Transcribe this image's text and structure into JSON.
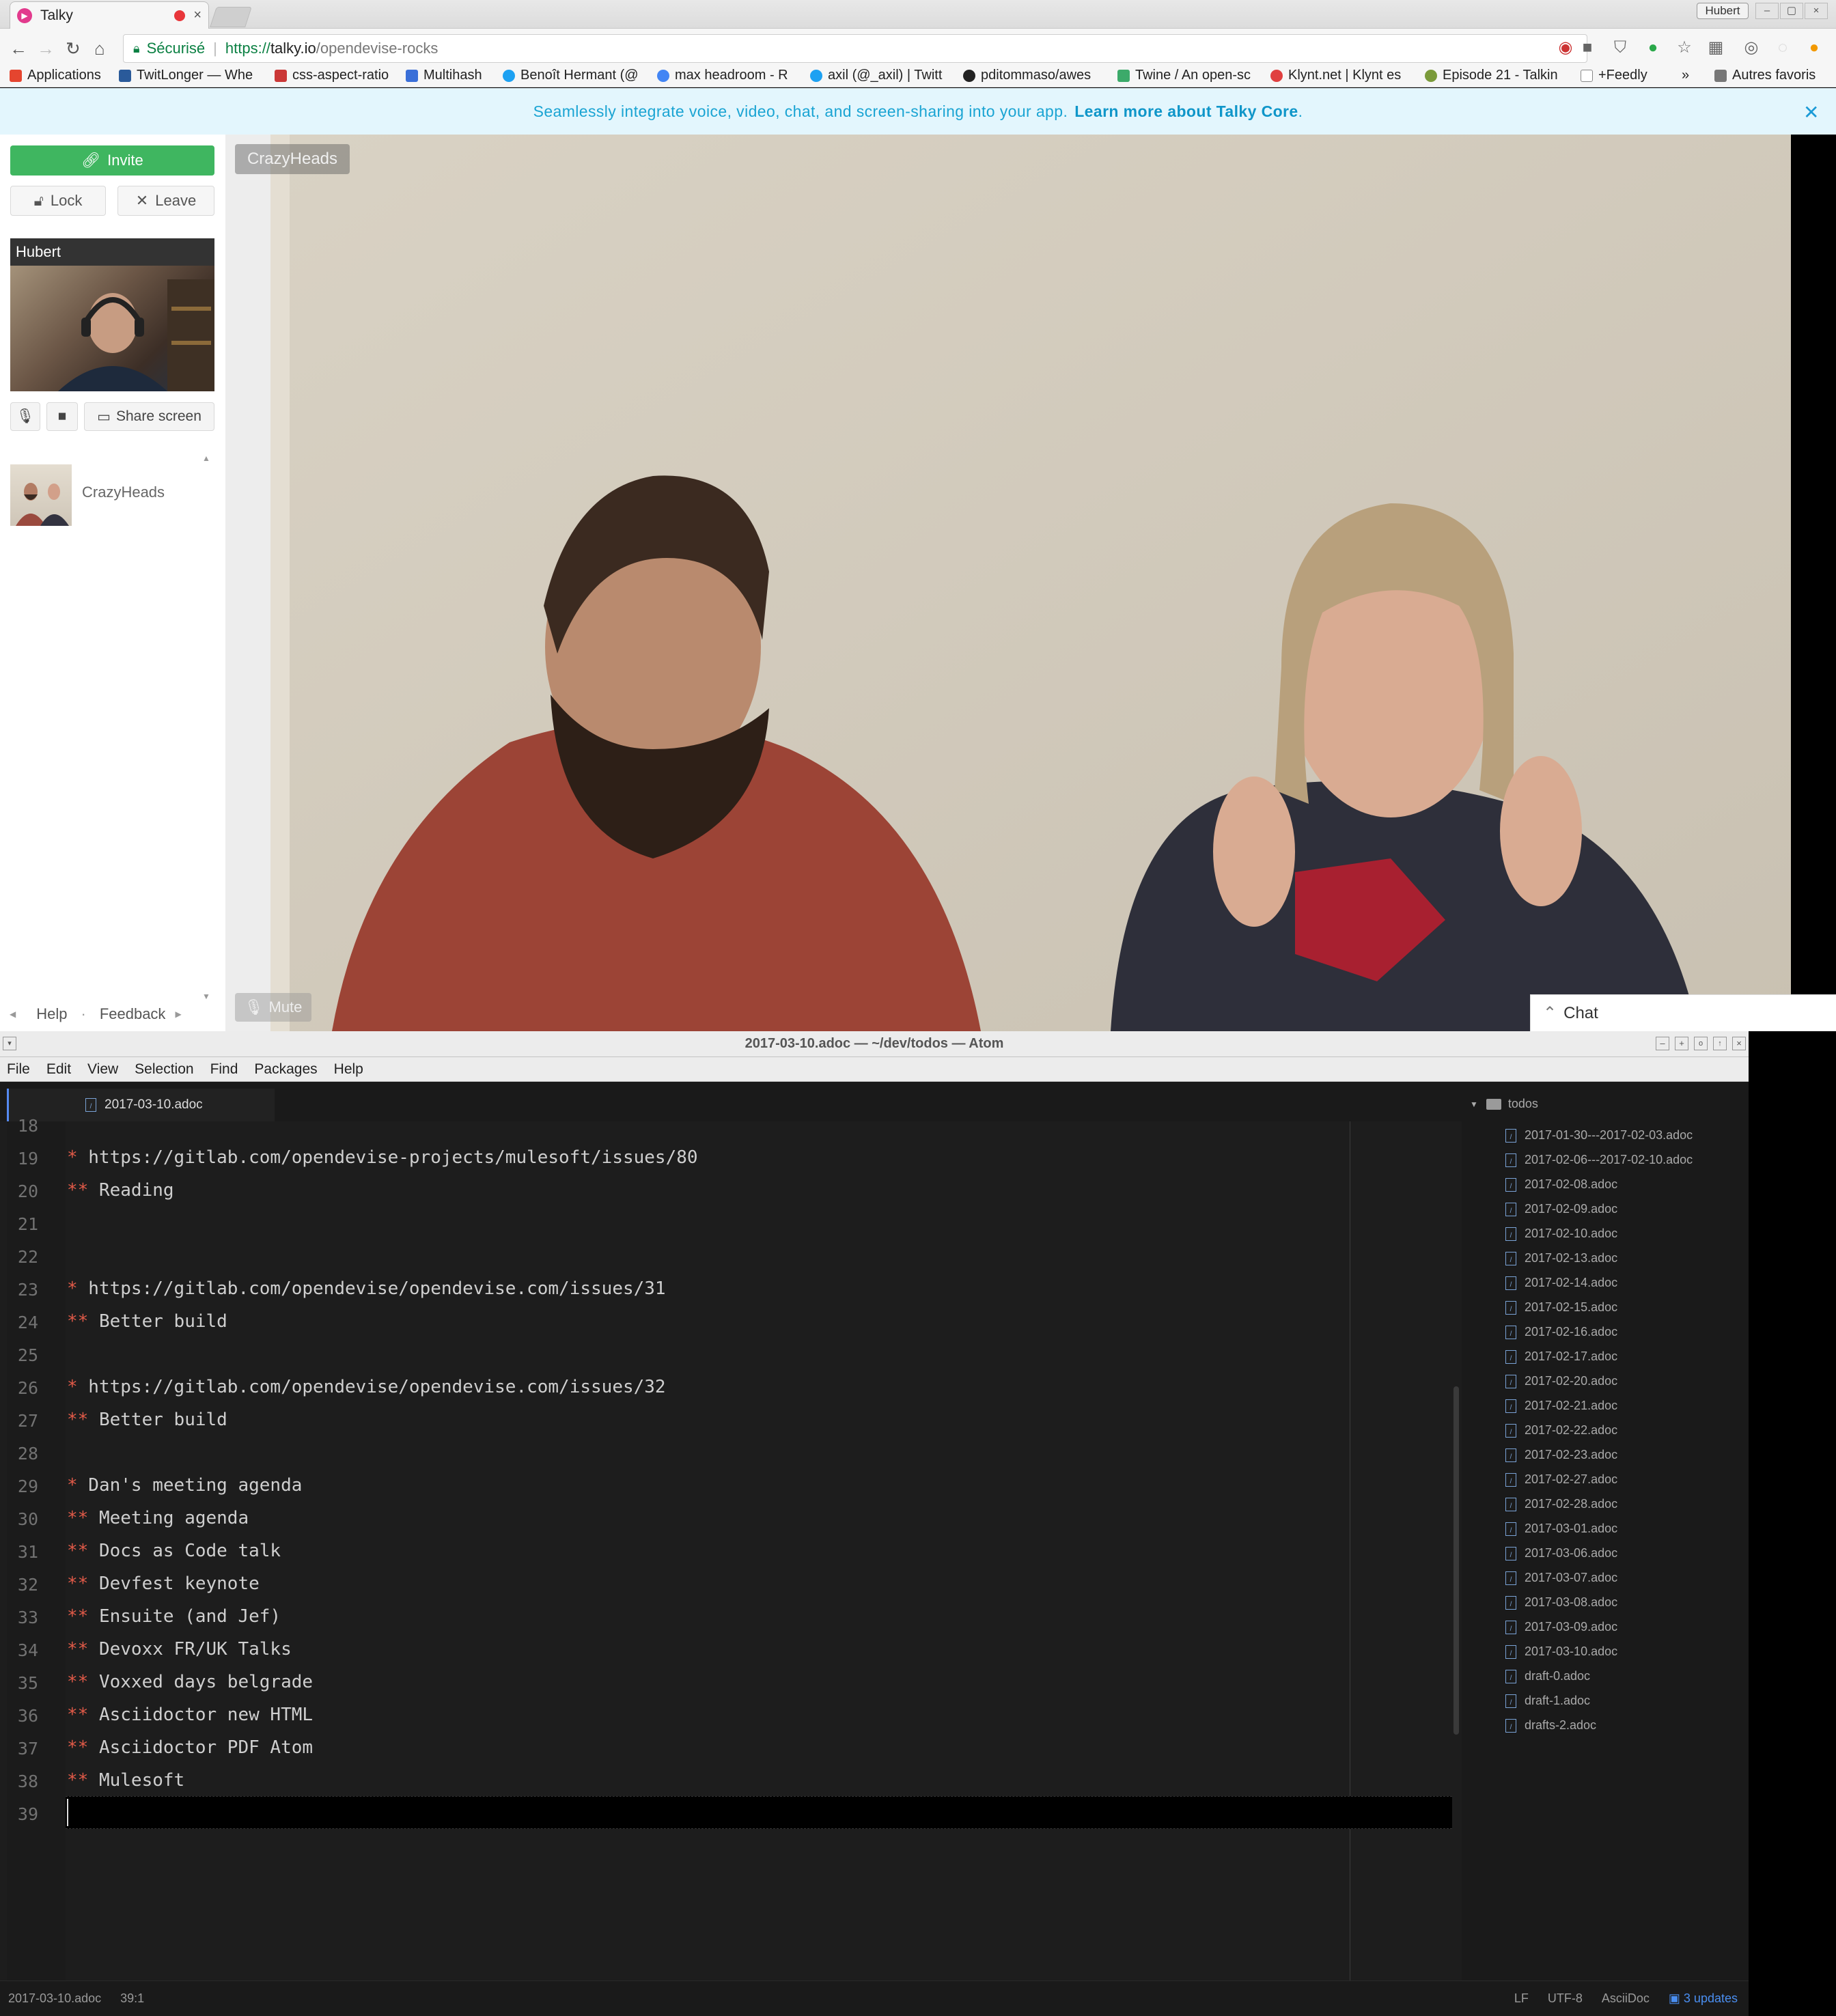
{
  "browser": {
    "tab_title": "Talky",
    "profile": "Hubert",
    "secure_label": "Sécurisé",
    "url_scheme": "https://",
    "url_host": "talky.io",
    "url_path": "/opendevise-rocks",
    "bookmarks": [
      {
        "label": "Applications",
        "icon": "apps-grid-icon",
        "color": "#e5452f"
      },
      {
        "label": "TwitLonger — Whe",
        "icon": "twitlonger-icon",
        "color": "#2a5a9a"
      },
      {
        "label": "css-aspect-ratio",
        "icon": "npm-icon",
        "color": "#cb3837"
      },
      {
        "label": "Multihash",
        "icon": "folder-icon",
        "color": "#3a6fd8"
      },
      {
        "label": "Benoît Hermant (@",
        "icon": "twitter-icon",
        "color": "#1da1f2"
      },
      {
        "label": "max headroom - R",
        "icon": "google-icon",
        "color": "#4285f4"
      },
      {
        "label": "axil (@_axil) | Twitt",
        "icon": "twitter-icon",
        "color": "#1da1f2"
      },
      {
        "label": "pditommaso/awes",
        "icon": "github-icon",
        "color": "#222222"
      },
      {
        "label": "Twine / An open-sc",
        "icon": "twine-icon",
        "color": "#3caa6a"
      },
      {
        "label": "Klynt.net | Klynt es",
        "icon": "klynt-icon",
        "color": "#e04040"
      },
      {
        "label": "Episode 21 - Talkin",
        "icon": "podcast-icon",
        "color": "#7a9a3a"
      },
      {
        "label": "+Feedly",
        "icon": "page-icon",
        "color": "#888888"
      }
    ],
    "bookmarks_more": "»",
    "other_bookmarks": "Autres favoris"
  },
  "talky": {
    "banner_text": "Seamlessly integrate voice, video, chat, and screen-sharing into your app.",
    "banner_link": "Learn more about Talky Core",
    "banner_period": ".",
    "invite": "Invite",
    "lock": "Lock",
    "leave": "Leave",
    "self_name": "Hubert",
    "share_screen": "Share screen",
    "peer_name": "CrazyHeads",
    "help": "Help",
    "feedback": "Feedback",
    "separator": "·",
    "video_label": "CrazyHeads",
    "mute": "Mute",
    "chat": "Chat"
  },
  "atom": {
    "window_title": "2017-03-10.adoc — ~/dev/todos — Atom",
    "menu": [
      "File",
      "Edit",
      "View",
      "Selection",
      "Find",
      "Packages",
      "Help"
    ],
    "tab": "2017-03-10.adoc",
    "lines": [
      {
        "n": "18",
        "bullet": "",
        "text": ""
      },
      {
        "n": "19",
        "bullet": "*",
        "text": " https://gitlab.com/opendevise-projects/mulesoft/issues/80"
      },
      {
        "n": "20",
        "bullet": "**",
        "text": " Reading"
      },
      {
        "n": "21",
        "bullet": "",
        "text": ""
      },
      {
        "n": "22",
        "bullet": "",
        "text": ""
      },
      {
        "n": "23",
        "bullet": "*",
        "text": " https://gitlab.com/opendevise/opendevise.com/issues/31"
      },
      {
        "n": "24",
        "bullet": "**",
        "text": " Better build"
      },
      {
        "n": "25",
        "bullet": "",
        "text": ""
      },
      {
        "n": "26",
        "bullet": "*",
        "text": " https://gitlab.com/opendevise/opendevise.com/issues/32"
      },
      {
        "n": "27",
        "bullet": "**",
        "text": " Better build"
      },
      {
        "n": "28",
        "bullet": "",
        "text": ""
      },
      {
        "n": "29",
        "bullet": "*",
        "text": " Dan's meeting agenda"
      },
      {
        "n": "30",
        "bullet": "**",
        "text": " Meeting agenda"
      },
      {
        "n": "31",
        "bullet": "**",
        "text": " Docs as Code talk"
      },
      {
        "n": "32",
        "bullet": "**",
        "text": " Devfest keynote"
      },
      {
        "n": "33",
        "bullet": "**",
        "text": " Ensuite (and Jef)"
      },
      {
        "n": "34",
        "bullet": "**",
        "text": " Devoxx FR/UK Talks"
      },
      {
        "n": "35",
        "bullet": "**",
        "text": " Voxxed days belgrade"
      },
      {
        "n": "36",
        "bullet": "**",
        "text": " Asciidoctor new HTML"
      },
      {
        "n": "37",
        "bullet": "**",
        "text": " Asciidoctor PDF Atom"
      },
      {
        "n": "38",
        "bullet": "**",
        "text": " Mulesoft"
      },
      {
        "n": "39",
        "bullet": "",
        "text": ""
      }
    ],
    "tree_root": "todos",
    "tree_files": [
      "2017-01-30---2017-02-03.adoc",
      "2017-02-06---2017-02-10.adoc",
      "2017-02-08.adoc",
      "2017-02-09.adoc",
      "2017-02-10.adoc",
      "2017-02-13.adoc",
      "2017-02-14.adoc",
      "2017-02-15.adoc",
      "2017-02-16.adoc",
      "2017-02-17.adoc",
      "2017-02-20.adoc",
      "2017-02-21.adoc",
      "2017-02-22.adoc",
      "2017-02-23.adoc",
      "2017-02-27.adoc",
      "2017-02-28.adoc",
      "2017-03-01.adoc",
      "2017-03-06.adoc",
      "2017-03-07.adoc",
      "2017-03-08.adoc",
      "2017-03-09.adoc",
      "2017-03-10.adoc",
      "draft-0.adoc",
      "draft-1.adoc",
      "drafts-2.adoc"
    ],
    "status": {
      "file": "2017-03-10.adoc",
      "cursor": "39:1",
      "line_ending": "LF",
      "encoding": "UTF-8",
      "grammar": "AsciiDoc",
      "updates": "3 updates"
    }
  },
  "colors": {
    "talky_green": "#3fb660",
    "talky_blue": "#1aa4d3",
    "bullet_red": "#e05a48",
    "atom_accent": "#568af2"
  }
}
